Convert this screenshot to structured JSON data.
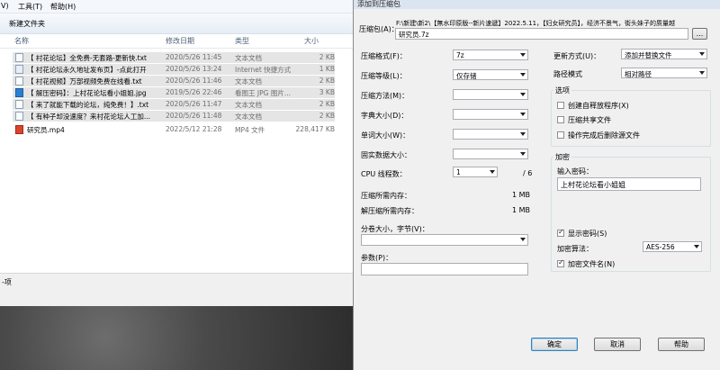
{
  "explorer": {
    "menu": [
      "V)",
      "工具(T)",
      "帮助(H)"
    ],
    "toolbar_new_folder": "新建文件夹",
    "columns": {
      "name": "名称",
      "date": "修改日期",
      "type": "类型",
      "size": "大小"
    },
    "files": [
      {
        "name": "【 村花论坛】全免费-无套路-更新快.txt",
        "date": "2020/5/26 11:45",
        "type": "文本文档",
        "size": "2 KB",
        "icon": "text-file-icon"
      },
      {
        "name": "【 村花论坛永久地址发布页】-点此打开",
        "date": "2020/5/26 13:24",
        "type": "Internet 快捷方式",
        "size": "1 KB",
        "icon": "shortcut-icon"
      },
      {
        "name": "【 村花视频】万部视频免费在线看.txt",
        "date": "2020/5/26 11:46",
        "type": "文本文档",
        "size": "2 KB",
        "icon": "text-file-icon"
      },
      {
        "name": "【 解压密码】：上村花论坛看小姐姐.jpg",
        "date": "2019/5/26 22:46",
        "type": "看图王 JPG 图片...",
        "size": "3 KB",
        "icon": "image-file-icon"
      },
      {
        "name": "【 来了就能下载的论坛，纯免费！】.txt",
        "date": "2020/5/26 11:47",
        "type": "文本文档",
        "size": "2 KB",
        "icon": "text-file-icon"
      },
      {
        "name": "【 有种子却没速度？来村花论坛人工加...",
        "date": "2020/5/26 11:48",
        "type": "文本文档",
        "size": "2 KB",
        "icon": "text-file-icon"
      },
      {
        "name": "研究员.mp4",
        "date": "2022/5/12 21:28",
        "type": "MP4 文件",
        "size": "228,417 KB",
        "icon": "video-file-icon"
      }
    ],
    "status_text": "-项"
  },
  "dialog": {
    "title": "添加到压缩包",
    "archive_label": "压缩包(A)：",
    "archive_path": "F:\\新建\\新2\\【無水印原版--新片速遞】2022.5.11，【妇女研究员】，经济不景气，街头妹子的质量越",
    "archive_path_line2": "研究员.7z",
    "browse_label": "...",
    "format_label": "压缩格式(F)：",
    "format_value": "7z",
    "level_label": "压缩等级(L)：",
    "level_value": "仅存储",
    "method_label": "压缩方法(M)：",
    "dict_label": "字典大小(D)：",
    "word_label": "单词大小(W)：",
    "solid_label": "固实数据大小：",
    "cpu_label": "CPU 线程数：",
    "cpu_value": "1",
    "cpu_total": "/ 6",
    "mem_comp_label": "压缩所需内存：",
    "mem_comp_value": "1 MB",
    "mem_decomp_label": "解压缩所需内存：",
    "mem_decomp_value": "1 MB",
    "split_label": "分卷大小，字节(V)：",
    "params_label": "参数(P)：",
    "update_label": "更新方式(U)：",
    "update_value": "添加并替换文件",
    "pathmode_label": "路径模式",
    "pathmode_value": "相对路径",
    "options_title": "选项",
    "opt_sfx": "创建自释放程序(X)",
    "opt_shared": "压缩共享文件",
    "opt_delete": "操作完成后删除源文件",
    "encrypt_title": "加密",
    "password_label": "输入密码：",
    "password_value": "上村花论坛看小姐姐",
    "show_password": "显示密码(S)",
    "enc_method_label": "加密算法：",
    "enc_method_value": "AES-256",
    "encrypt_names": "加密文件名(N)",
    "ok": "确定",
    "cancel": "取消",
    "help": "帮助"
  }
}
